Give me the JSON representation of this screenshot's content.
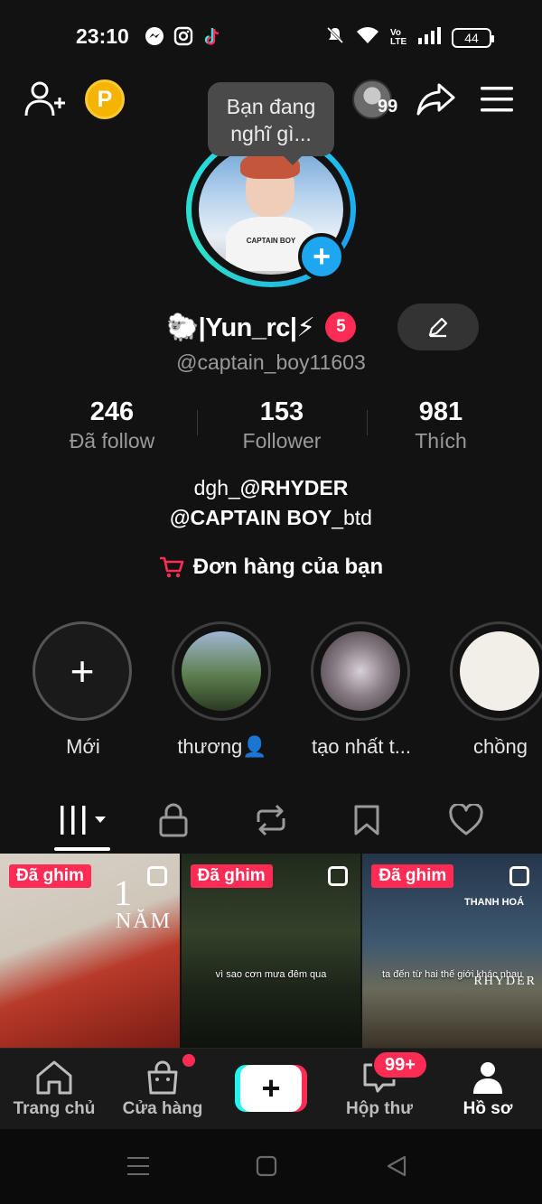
{
  "status_bar": {
    "time": "23:10",
    "app_icons": [
      "messenger-icon",
      "instagram-icon",
      "tiktok-icon"
    ],
    "system_icons": [
      "mute-icon",
      "wifi-icon",
      "volte-icon",
      "signal-icon"
    ],
    "volte_label": "Vo LTE",
    "battery": "44"
  },
  "top_nav": {
    "points_label": "P",
    "tooltip": "Bạn đang nghĩ gì...",
    "friends_count": "99"
  },
  "profile": {
    "display_name": "🐑|Yun_rc|⚡",
    "name_badge": "5",
    "username": "@captain_boy11603",
    "avatar_caption": "CAPTAIN BOY"
  },
  "stats": [
    {
      "value": "246",
      "label": "Đã follow"
    },
    {
      "value": "153",
      "label": "Follower"
    },
    {
      "value": "981",
      "label": "Thích"
    }
  ],
  "bio": {
    "line1_prefix": "dgh_",
    "line1_bold": "@RHYDER",
    "line2_bold": "@CAPTAIN BOY",
    "line2_suffix": "_btd"
  },
  "orders_label": "Đơn hàng của bạn",
  "highlights": [
    {
      "label": "Mới"
    },
    {
      "label": "thương👤"
    },
    {
      "label": "tạo nhất t..."
    },
    {
      "label": "chồng"
    }
  ],
  "tabs": [
    "videos-grid-icon",
    "lock-icon",
    "repost-icon",
    "bookmark-icon",
    "heart-icon"
  ],
  "videos": [
    {
      "pin": "Đã ghim",
      "overlay_big": "1",
      "overlay_sub": "NĂM",
      "caption": ""
    },
    {
      "pin": "Đã ghim",
      "caption": "vì sao cơn mưa đêm qua"
    },
    {
      "pin": "Đã ghim",
      "caption": "ta đến từ hai thế giới khác nhau",
      "overlay_place": "THANH HOÁ",
      "overlay_brand": "RHYDER"
    }
  ],
  "bottom_nav": {
    "home": "Trang chủ",
    "shop": "Cửa hàng",
    "create": "+",
    "inbox": "Hộp thư",
    "inbox_badge": "99+",
    "profile": "Hồ sơ"
  },
  "colors": {
    "accent_red": "#fe2c55",
    "accent_cyan": "#25f4ee",
    "ring_blue": "#1ea7f0",
    "points_gold": "#f5b401"
  }
}
